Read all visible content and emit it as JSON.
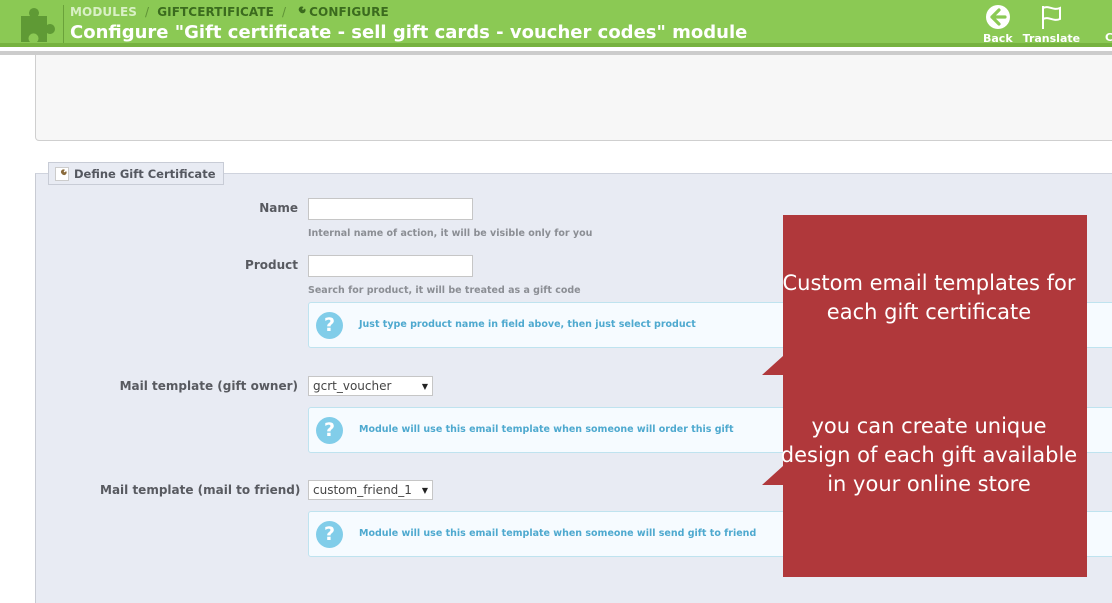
{
  "header": {
    "breadcrumb": [
      "MODULES",
      "GIFTCERTIFICATE",
      "CONFIGURE"
    ],
    "title": "Configure \"Gift certificate - sell gift cards - voucher codes\" module",
    "toolbar": [
      {
        "label": "Back",
        "icon": "arrow-left-circle-icon"
      },
      {
        "label": "Translate",
        "icon": "flag-icon"
      }
    ],
    "toolbar_overflow": "C",
    "colors": {
      "bar": "#8bc954",
      "bar_border": "#76b23f"
    }
  },
  "form": {
    "legend": "Define Gift Certificate",
    "fields": [
      {
        "label": "Name",
        "value": "",
        "hint": "Internal name of action, it will be visible only for you"
      },
      {
        "label": "Product",
        "value": "",
        "hint": "Search for product, it will be treated as a gift code",
        "info": "Just type product name in field above, then just select product"
      },
      {
        "label": "Mail template (gift owner)",
        "selected": "gcrt_voucher",
        "info": "Module will use this email template when someone will order this gift"
      },
      {
        "label": "Mail template (mail to friend)",
        "selected": "custom_friend_1",
        "info": "Module will use this email template when someone will send gift to friend"
      }
    ]
  },
  "callout": {
    "text_1": "Custom email templates for each gift certificate",
    "text_2": "you can create unique design of each gift available in your online store",
    "color": "#b0383b"
  }
}
